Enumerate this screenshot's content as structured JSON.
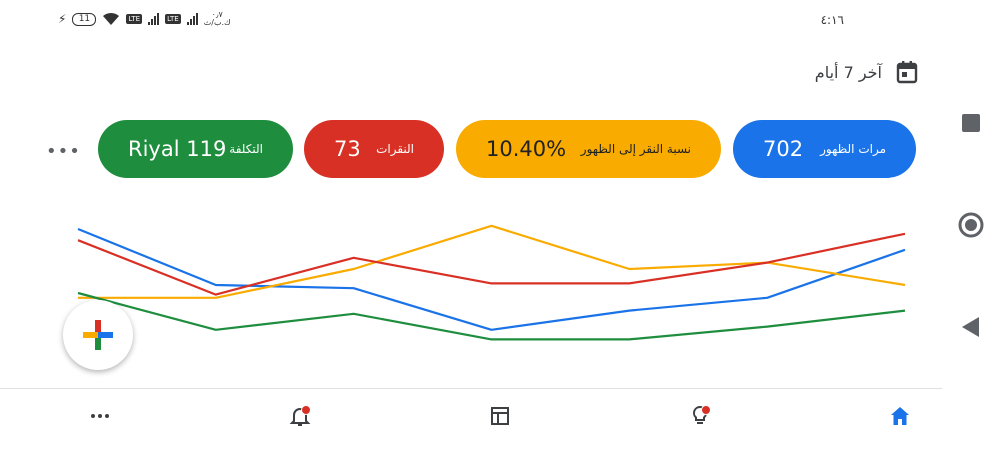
{
  "status_bar": {
    "time": "٤:١٦",
    "battery": "11",
    "network": "LTE",
    "speed_top": "٠٫٧",
    "speed_bottom": "ك.ب/ث"
  },
  "date_range": {
    "label": "آخر 7 أيام",
    "icon": "calendar-icon"
  },
  "metrics": [
    {
      "label": "مرات الظهور",
      "value": "702",
      "color": "#1a73e8"
    },
    {
      "label": "نسبة النقر إلى الظهور",
      "value": "10.40%",
      "color": "#f9ab00"
    },
    {
      "label": "النقرات",
      "value": "73",
      "color": "#d93025"
    },
    {
      "label": "التكلفة",
      "value": "Riyal 119",
      "color": "#1e8e3e"
    }
  ],
  "more_menu": {
    "icon": "more-horiz-icon"
  },
  "chart_data": {
    "type": "line",
    "x": [
      1,
      2,
      3,
      4,
      5,
      6,
      7
    ],
    "ylim": [
      0,
      100
    ],
    "grid": false,
    "series": [
      {
        "color": "#1a73e8",
        "values": [
          85,
          50,
          48,
          22,
          34,
          42,
          72
        ]
      },
      {
        "color": "#f9ab00",
        "values": [
          42,
          42,
          60,
          87,
          60,
          64,
          50
        ]
      },
      {
        "color": "#d93025",
        "values": [
          78,
          44,
          67,
          51,
          51,
          64,
          82
        ]
      },
      {
        "color": "#1e8e3e",
        "values": [
          45,
          22,
          32,
          16,
          16,
          24,
          34
        ]
      }
    ]
  },
  "fab": {
    "icon": "plus-icon"
  },
  "bottom_nav": [
    {
      "name": "home",
      "icon": "home-icon",
      "active": true
    },
    {
      "name": "recommendations",
      "icon": "lightbulb-icon",
      "badge": true
    },
    {
      "name": "campaigns",
      "icon": "table-icon"
    },
    {
      "name": "notifications",
      "icon": "bell-icon",
      "badge": true
    },
    {
      "name": "more",
      "icon": "more-horiz-icon"
    }
  ],
  "system_nav": [
    "square-icon",
    "circle-icon",
    "back-triangle-icon"
  ],
  "colors": {
    "blue": "#1a73e8",
    "yellow": "#f9ab00",
    "red": "#d93025",
    "green": "#1e8e3e"
  }
}
